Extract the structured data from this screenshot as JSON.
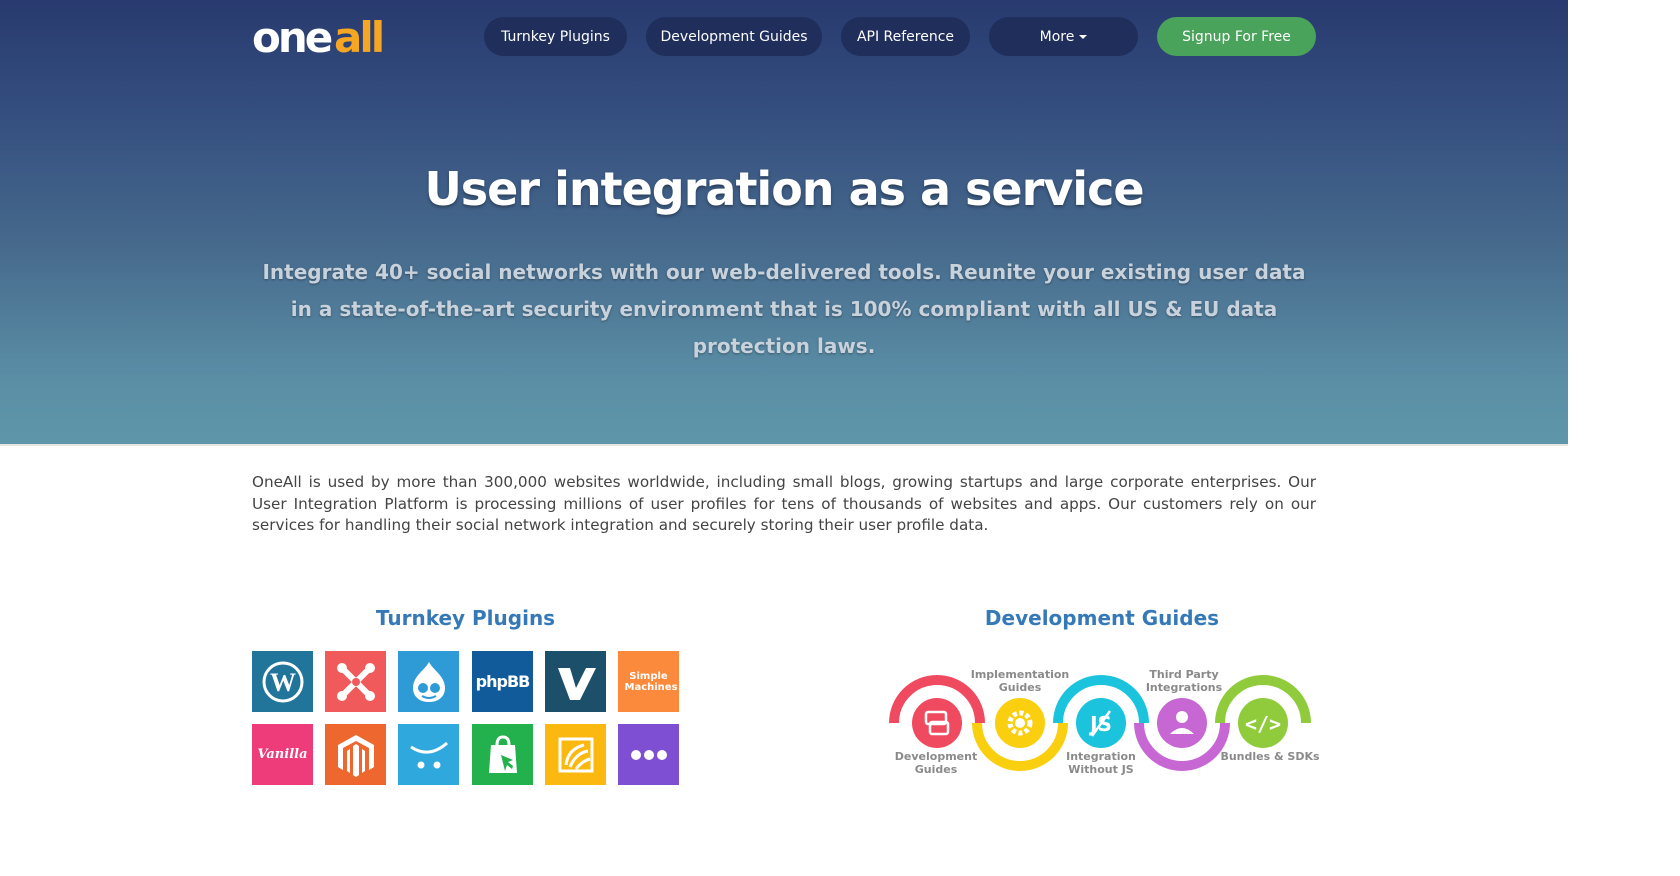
{
  "header": {
    "logo": {
      "part1": "one",
      "part2": "all"
    },
    "nav": [
      {
        "label": "Turnkey Plugins"
      },
      {
        "label": "Development Guides"
      },
      {
        "label": "API Reference"
      },
      {
        "label": "More"
      }
    ],
    "signup_label": "Signup For Free"
  },
  "hero": {
    "title": "User integration as a service",
    "subtitle": "Integrate 40+ social networks with our web-delivered tools. Reunite your existing user data in a state-of-the-art security environment that is 100% compliant with all US & EU data protection laws."
  },
  "intro": "OneAll is used by more than 300,000 websites worldwide, including small blogs, growing startups and large corporate enterprises. Our User Integration Platform is processing millions of user profiles for tens of thousands of websites and apps. Our customers rely on our services for handling their social network integration and securely storing their user profile data.",
  "plugins": {
    "title": "Turnkey Plugins",
    "tiles": [
      {
        "icon": "wordpress-icon",
        "color": "#21759b"
      },
      {
        "icon": "joomla-icon",
        "color": "#f05a5a"
      },
      {
        "icon": "drupal-icon",
        "color": "#2f9bd6"
      },
      {
        "icon": "phpbb-icon",
        "color": "#115b9a",
        "text": "phpBB"
      },
      {
        "icon": "vbulletin-icon",
        "color": "#1c4f6a"
      },
      {
        "icon": "simple-machines-icon",
        "color": "#fb8a3c",
        "text": "Simple Machines"
      },
      {
        "icon": "vanilla-icon",
        "color": "#ee3b7a",
        "text": "Vanilla"
      },
      {
        "icon": "magento-icon",
        "color": "#ee672f"
      },
      {
        "icon": "opencart-icon",
        "color": "#2ea8dd"
      },
      {
        "icon": "shopify-icon",
        "color": "#22b14c"
      },
      {
        "icon": "prestashop-icon",
        "color": "#fbb80f"
      },
      {
        "icon": "more-plugins-icon",
        "color": "#7f4fd3"
      }
    ]
  },
  "guides": {
    "title": "Development Guides",
    "items": [
      {
        "label": "Development Guides",
        "icon": "document-icon",
        "color": "#ef4a5f"
      },
      {
        "label": "Implementation Guides",
        "icon": "gear-icon",
        "color": "#f9cf0f"
      },
      {
        "label": "Integration Without JS",
        "icon": "no-js-icon",
        "color": "#1bc3dd"
      },
      {
        "label": "Third Party Integrations",
        "icon": "user-icon",
        "color": "#c667d4"
      },
      {
        "label": "Bundles & SDKs",
        "icon": "code-icon",
        "color": "#8fcb3b"
      }
    ]
  }
}
